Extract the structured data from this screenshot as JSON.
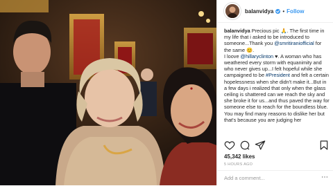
{
  "post": {
    "username": "balanvidya",
    "follow_label": "Follow",
    "separator": "•",
    "caption": {
      "username": "balanvidya",
      "p1_a": " Precious pic ",
      "p1_emoji": "🙏",
      "p1_b": ". The first time in my life that i asked to be introduced to someone...Thank you ",
      "mention1": "@smritiraniofficial",
      "p1_c": " for the same ",
      "p1_smile": "😊",
      "p1_d": ".",
      "p2_a": "I loove ",
      "mention2": "@hillaryclinton",
      "p2_heart": " ♥",
      "p2_b": ". A woman who has weathered every storm with equanimity and who never gives up...I felt hopeful while she campaigned to be ",
      "hashtag": "#President",
      "p2_c": " and felt a certain hopelessness when she didn't make it...But in a few days i realized that only when the glass ceiling is shattered can we reach the sky and she broke it for us...and thus paved the way for someone else to reach for the boundless blue.",
      "p3": "You may find many reasons to dislike her but that's because you are judging her"
    },
    "likes": "45,342 likes",
    "time_ago": "5 HOURS AGO",
    "comment_placeholder": "Add a comment..."
  },
  "colors": {
    "link_blue": "#3897f0",
    "mention_blue": "#003569",
    "text": "#262626",
    "muted": "#999999"
  },
  "icons": [
    "heart-icon",
    "comment-icon",
    "share-icon",
    "bookmark-icon",
    "verified-badge-icon",
    "more-options-icon"
  ]
}
